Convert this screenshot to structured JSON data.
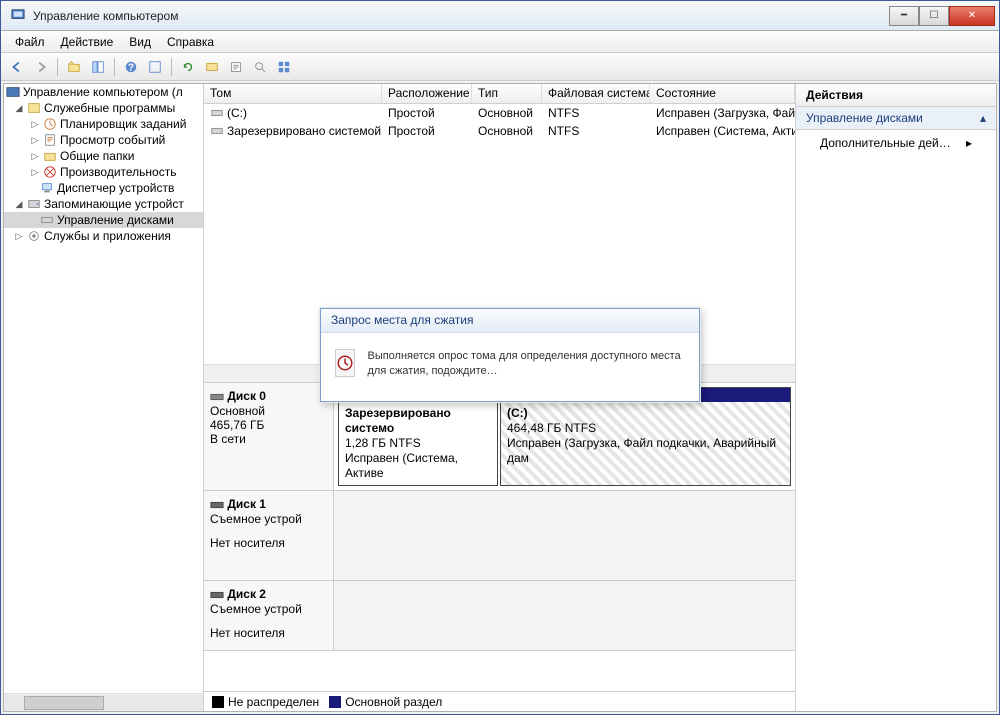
{
  "window": {
    "title": "Управление компьютером"
  },
  "menu": [
    "Файл",
    "Действие",
    "Вид",
    "Справка"
  ],
  "tree": {
    "root": "Управление компьютером (л",
    "system_tools": "Служебные программы",
    "task_scheduler": "Планировщик заданий",
    "event_viewer": "Просмотр событий",
    "shared_folders": "Общие папки",
    "performance": "Производительность",
    "device_manager": "Диспетчер устройств",
    "storage": "Запоминающие устройст",
    "disk_mgmt": "Управление дисками",
    "services_apps": "Службы и приложения"
  },
  "columns": {
    "vol": "Том",
    "layout": "Расположение",
    "type": "Тип",
    "fs": "Файловая система",
    "status": "Состояние"
  },
  "volumes": [
    {
      "name": "(C:)",
      "layout": "Простой",
      "type": "Основной",
      "fs": "NTFS",
      "status": "Исправен (Загрузка, Фай"
    },
    {
      "name": "Зарезервировано системой",
      "layout": "Простой",
      "type": "Основной",
      "fs": "NTFS",
      "status": "Исправен (Система, Акти"
    }
  ],
  "disks": {
    "d0": {
      "name": "Диск 0",
      "type": "Основной",
      "size": "465,76 ГБ",
      "status": "В сети",
      "p0": {
        "title": "Зарезервировано системо",
        "size": "1,28 ГБ NTFS",
        "status": "Исправен (Система, Активе"
      },
      "p1": {
        "title": "(C:)",
        "size": "464,48 ГБ NTFS",
        "status": "Исправен (Загрузка, Файл подкачки, Аварийный дам"
      }
    },
    "d1": {
      "name": "Диск 1",
      "type": "Съемное устрой",
      "status": "Нет носителя"
    },
    "d2": {
      "name": "Диск 2",
      "type": "Съемное устрой",
      "status": "Нет носителя"
    }
  },
  "legend": {
    "unalloc": "Не распределен",
    "primary": "Основной раздел"
  },
  "actions": {
    "header": "Действия",
    "disk_mgmt": "Управление дисками",
    "more": "Дополнительные дей…"
  },
  "modal": {
    "title": "Запрос места для сжатия",
    "text": "Выполняется опрос тома для определения доступного места для сжатия, подождите…"
  }
}
